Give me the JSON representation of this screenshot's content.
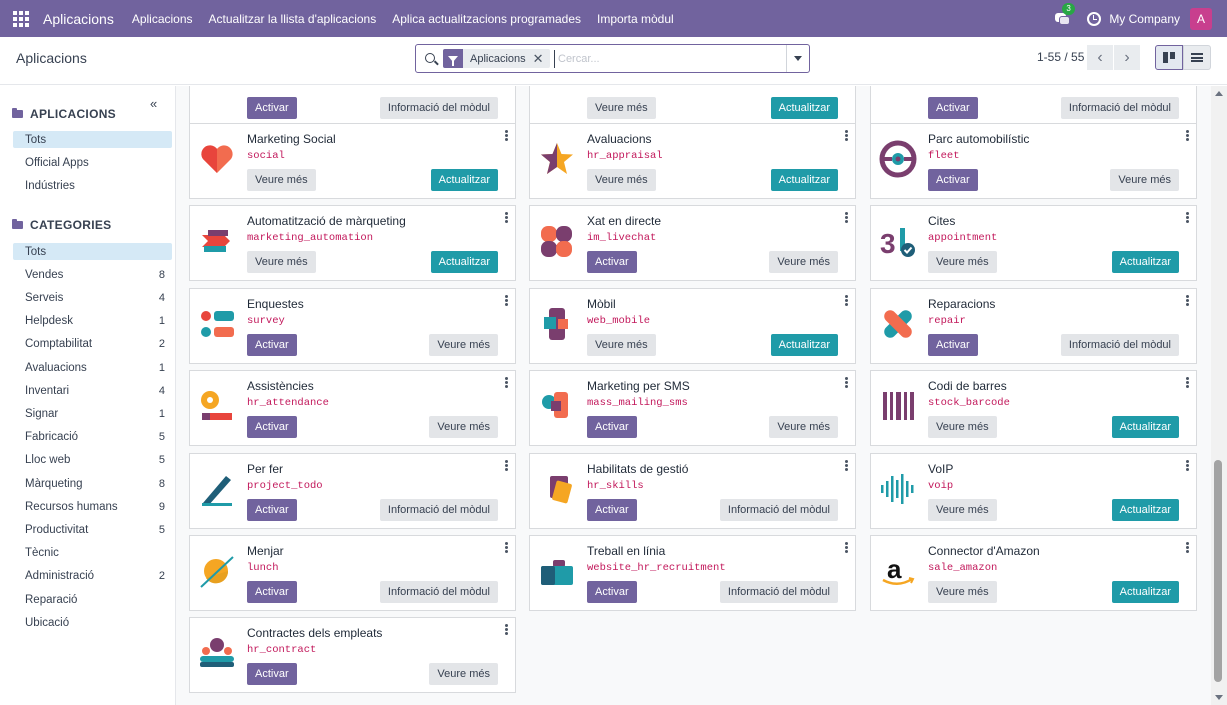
{
  "navbar": {
    "brand": "Aplicacions",
    "menus": [
      "Aplicacions",
      "Actualitzar la llista d'aplicacions",
      "Aplica actualitzacions programades",
      "Importa mòdul"
    ],
    "chat_count": "3",
    "company": "My Company",
    "avatar": "A"
  },
  "control": {
    "breadcrumb": "Aplicacions",
    "facet": "Aplicacions",
    "search_placeholder": "Cercar...",
    "pager": "1-55 / 55"
  },
  "sidebar": {
    "apps_header": "APLICACIONS",
    "apps_items": [
      "Tots",
      "Official Apps",
      "Indústries"
    ],
    "categories_header": "CATEGORIES",
    "categories": [
      {
        "label": "Tots",
        "count": ""
      },
      {
        "label": "Vendes",
        "count": "8"
      },
      {
        "label": "Serveis",
        "count": "4"
      },
      {
        "label": "Helpdesk",
        "count": "1"
      },
      {
        "label": "Comptabilitat",
        "count": "2"
      },
      {
        "label": "Avaluacions",
        "count": "1"
      },
      {
        "label": "Inventari",
        "count": "4"
      },
      {
        "label": "Signar",
        "count": "1"
      },
      {
        "label": "Fabricació",
        "count": "5"
      },
      {
        "label": "Lloc web",
        "count": "5"
      },
      {
        "label": "Màrqueting",
        "count": "8"
      },
      {
        "label": "Recursos humans",
        "count": "9"
      },
      {
        "label": "Productivitat",
        "count": "5"
      },
      {
        "label": "Tècnic",
        "count": ""
      },
      {
        "label": "Administració",
        "count": "2"
      },
      {
        "label": "Reparació",
        "count": ""
      },
      {
        "label": "Ubicació",
        "count": ""
      }
    ]
  },
  "top_partial": [
    {
      "left": "Activar",
      "left_style": "primary",
      "right": "Informació del mòdul",
      "right_style": "secondary"
    },
    {
      "left": "Veure més",
      "left_style": "secondary",
      "right": "Actualitzar",
      "right_style": "info"
    },
    {
      "left": "Activar",
      "left_style": "primary",
      "right": "Informació del mòdul",
      "right_style": "secondary"
    }
  ],
  "apps": [
    {
      "name": "Marketing Social",
      "tech": "social",
      "icon": "social-heart-icon",
      "left": "Veure més",
      "left_style": "secondary",
      "right": "Actualitzar",
      "right_style": "info"
    },
    {
      "name": "Avaluacions",
      "tech": "hr_appraisal",
      "icon": "star-icon",
      "left": "Veure més",
      "left_style": "secondary",
      "right": "Actualitzar",
      "right_style": "info"
    },
    {
      "name": "Parc automobilístic",
      "tech": "fleet",
      "icon": "steering-wheel-icon",
      "left": "Activar",
      "left_style": "primary",
      "right": "Veure més",
      "right_style": "secondary"
    },
    {
      "name": "Automatització de màrqueting",
      "tech": "marketing_automation",
      "icon": "automation-arrows-icon",
      "left": "Veure més",
      "left_style": "secondary",
      "right": "Actualitzar",
      "right_style": "info"
    },
    {
      "name": "Xat en directe",
      "tech": "im_livechat",
      "icon": "chat-bubbles-icon",
      "left": "Activar",
      "left_style": "primary",
      "right": "Veure més",
      "right_style": "secondary"
    },
    {
      "name": "Cites",
      "tech": "appointment",
      "icon": "calendar-31-icon",
      "left": "Veure més",
      "left_style": "secondary",
      "right": "Actualitzar",
      "right_style": "info"
    },
    {
      "name": "Enquestes",
      "tech": "survey",
      "icon": "survey-options-icon",
      "left": "Activar",
      "left_style": "primary",
      "right": "Veure més",
      "right_style": "secondary"
    },
    {
      "name": "Mòbil",
      "tech": "web_mobile",
      "icon": "mobile-phone-icon",
      "left": "Veure més",
      "left_style": "secondary",
      "right": "Actualitzar",
      "right_style": "info"
    },
    {
      "name": "Reparacions",
      "tech": "repair",
      "icon": "bandage-icon",
      "left": "Activar",
      "left_style": "primary",
      "right": "Informació del mòdul",
      "right_style": "secondary"
    },
    {
      "name": "Assistències",
      "tech": "hr_attendance",
      "icon": "attendance-icon",
      "left": "Activar",
      "left_style": "primary",
      "right": "Veure més",
      "right_style": "secondary"
    },
    {
      "name": "Marketing per SMS",
      "tech": "mass_mailing_sms",
      "icon": "sms-icon",
      "left": "Activar",
      "left_style": "primary",
      "right": "Veure més",
      "right_style": "secondary"
    },
    {
      "name": "Codi de barres",
      "tech": "stock_barcode",
      "icon": "barcode-icon",
      "left": "Veure més",
      "left_style": "secondary",
      "right": "Actualitzar",
      "right_style": "info"
    },
    {
      "name": "Per fer",
      "tech": "project_todo",
      "icon": "pen-icon",
      "left": "Activar",
      "left_style": "primary",
      "right": "Informació del mòdul",
      "right_style": "secondary"
    },
    {
      "name": "Habilitats de gestió",
      "tech": "hr_skills",
      "icon": "skills-cards-icon",
      "left": "Activar",
      "left_style": "primary",
      "right": "Informació del mòdul",
      "right_style": "secondary"
    },
    {
      "name": "VoIP",
      "tech": "voip",
      "icon": "soundwave-icon",
      "left": "Veure més",
      "left_style": "secondary",
      "right": "Actualitzar",
      "right_style": "info"
    },
    {
      "name": "Menjar",
      "tech": "lunch",
      "icon": "lunch-icon",
      "left": "Activar",
      "left_style": "primary",
      "right": "Informació del mòdul",
      "right_style": "secondary"
    },
    {
      "name": "Treball en línia",
      "tech": "website_hr_recruitment",
      "icon": "briefcase-icon",
      "left": "Activar",
      "left_style": "primary",
      "right": "Informació del mòdul",
      "right_style": "secondary"
    },
    {
      "name": "Connector d'Amazon",
      "tech": "sale_amazon",
      "icon": "amazon-logo-icon",
      "left": "Veure més",
      "left_style": "secondary",
      "right": "Actualitzar",
      "right_style": "info"
    },
    {
      "name": "Contractes dels empleats",
      "tech": "hr_contract",
      "icon": "employees-icon",
      "left": "Activar",
      "left_style": "primary",
      "right": "Veure més",
      "right_style": "secondary"
    }
  ],
  "colors": {
    "brand": "#71639e",
    "info": "#1f9ba8",
    "secondary": "#e3e5e8",
    "tech": "#c2185b"
  }
}
